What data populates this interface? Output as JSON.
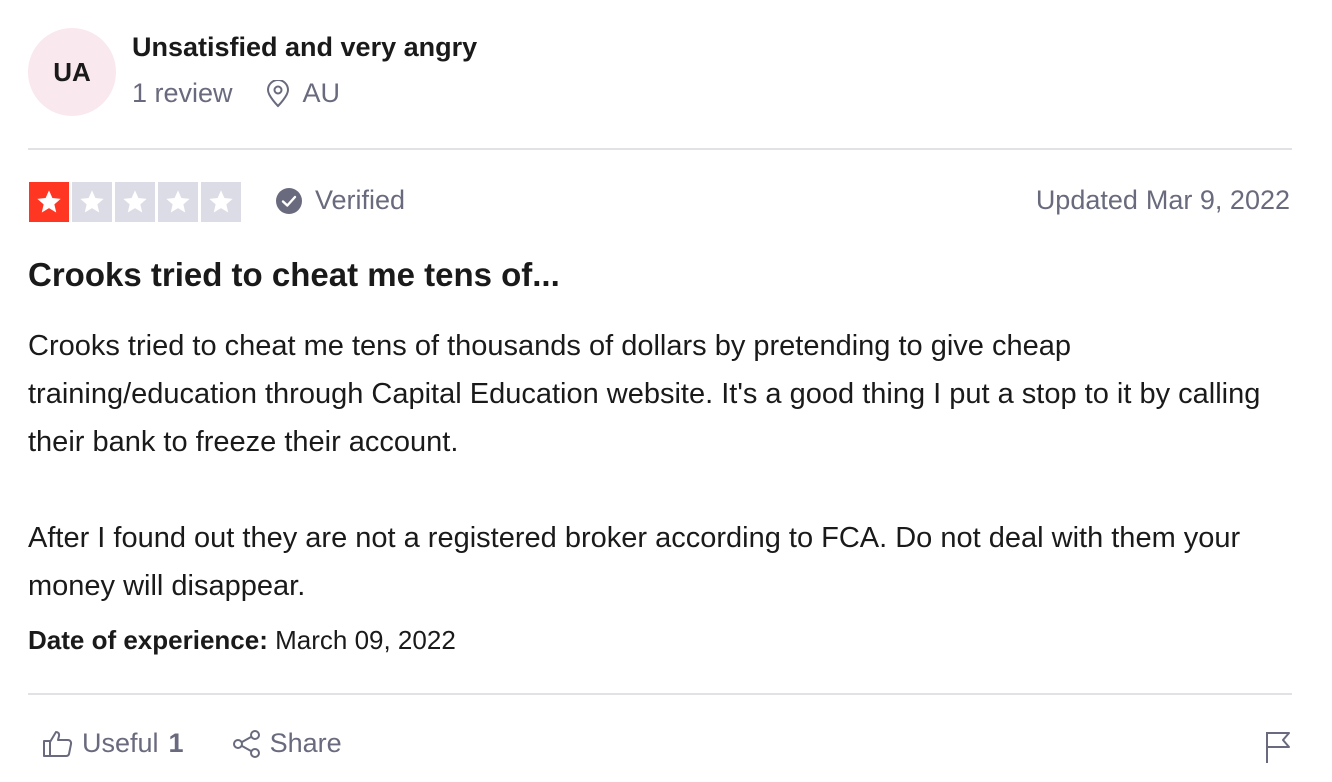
{
  "consumer": {
    "initials": "UA",
    "name": "Unsatisfied and very angry",
    "reviews": "1 review",
    "location": "AU"
  },
  "review": {
    "rating": 1,
    "max_rating": 5,
    "verified_label": "Verified",
    "updated_label": "Updated",
    "updated_date": "Mar 9, 2022",
    "title": "Crooks tried to cheat me tens of...",
    "paragraphs": [
      "Crooks tried to cheat me tens of thousands of dollars by pretending to give cheap training/education through Capital Education website. It's a good thing I put a stop to it by calling their bank to freeze their account.",
      "After I found out they are not a registered broker according to FCA. Do not deal with them your money will disappear."
    ],
    "experience_label": "Date of experience:",
    "experience_date": "March 09, 2022"
  },
  "actions": {
    "useful_label": "Useful",
    "useful_count": "1",
    "share_label": "Share"
  },
  "colors": {
    "star_filled": "#ff3722",
    "star_empty": "#dcdce6",
    "muted_text": "#696a7d",
    "avatar_bg": "#f9e8ee"
  },
  "icons": [
    "location-pin-icon",
    "star-icon",
    "verified-check-icon",
    "thumbs-up-icon",
    "share-icon",
    "flag-icon"
  ]
}
